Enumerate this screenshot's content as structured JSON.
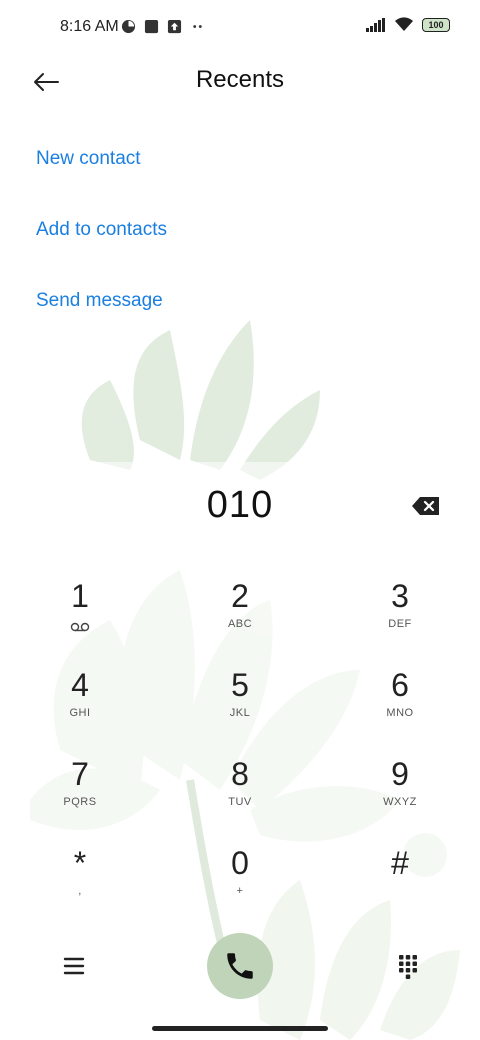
{
  "status_bar": {
    "time": "8:16 AM",
    "battery": "100"
  },
  "header": {
    "title": "Recents"
  },
  "actions": {
    "new_contact": "New contact",
    "add_to_contacts": "Add to contacts",
    "send_message": "Send message"
  },
  "dialer": {
    "number": "010"
  },
  "keypad": {
    "k1": {
      "digit": "1",
      "letters": ""
    },
    "k2": {
      "digit": "2",
      "letters": "ABC"
    },
    "k3": {
      "digit": "3",
      "letters": "DEF"
    },
    "k4": {
      "digit": "4",
      "letters": "GHI"
    },
    "k5": {
      "digit": "5",
      "letters": "JKL"
    },
    "k6": {
      "digit": "6",
      "letters": "MNO"
    },
    "k7": {
      "digit": "7",
      "letters": "PQRS"
    },
    "k8": {
      "digit": "8",
      "letters": "TUV"
    },
    "k9": {
      "digit": "9",
      "letters": "WXYZ"
    },
    "star": {
      "digit": "*",
      "letters": ","
    },
    "k0": {
      "digit": "0",
      "letters": "+"
    },
    "hash": {
      "digit": "#",
      "letters": ""
    }
  },
  "colors": {
    "accent": "#1a7fe0",
    "call_button": "#bfd4b8"
  },
  "icons": {
    "back": "back-arrow-icon",
    "backspace": "backspace-icon",
    "voicemail": "voicemail-icon",
    "menu": "menu-icon",
    "call": "phone-icon",
    "keypad": "dialpad-icon"
  }
}
